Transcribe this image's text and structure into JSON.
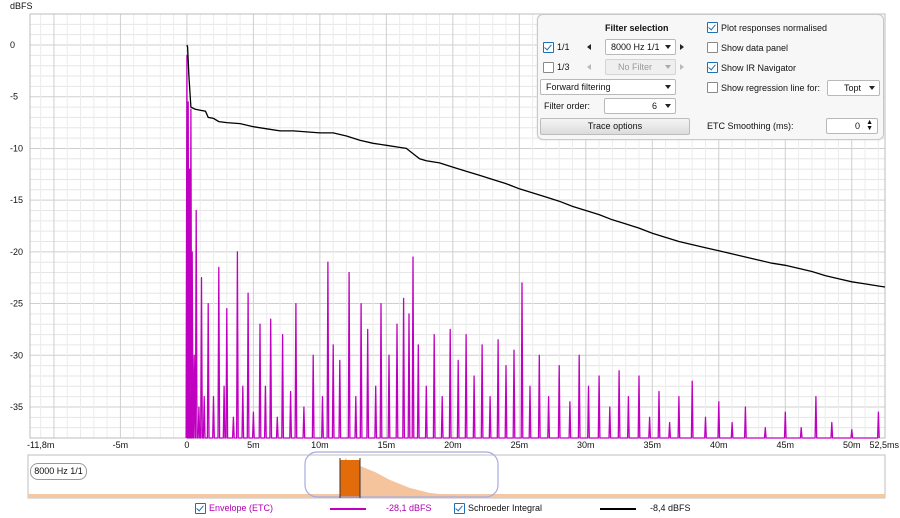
{
  "chart_data": {
    "type": "line",
    "ylabel": "dBFS",
    "xunit": "ms",
    "xlim": [
      -11.8,
      52.5
    ],
    "ylim": [
      -38,
      3
    ],
    "xticks": [
      -11.8,
      -5,
      0,
      5,
      10,
      15,
      20,
      25,
      30,
      35,
      40,
      45,
      50,
      52.5
    ],
    "xtick_labels": [
      "-11,8m",
      "-5m",
      "0",
      "5m",
      "10m",
      "15m",
      "20m",
      "25m",
      "30m",
      "35m",
      "40m",
      "45m",
      "50m",
      "52,5ms"
    ],
    "yticks": [
      0,
      -5,
      -10,
      -15,
      -20,
      -25,
      -30,
      -35
    ],
    "ytick_labels": [
      "0",
      "-5",
      "-10",
      "-15",
      "-20",
      "-25",
      "-30",
      "-35"
    ],
    "grid": true,
    "series": [
      {
        "name": "Envelope (ETC)",
        "color": "#c000c0",
        "style": "spiky",
        "points": [
          [
            0.0,
            -1.0
          ],
          [
            0.1,
            -5.5
          ],
          [
            0.2,
            -12.0
          ],
          [
            0.3,
            -6.2
          ],
          [
            0.4,
            -20.0
          ],
          [
            0.55,
            -30.0
          ],
          [
            0.7,
            -16.0
          ],
          [
            0.9,
            -35.0
          ],
          [
            1.1,
            -22.5
          ],
          [
            1.3,
            -34.0
          ],
          [
            1.6,
            -25.0
          ],
          [
            2.0,
            -34.0
          ],
          [
            2.4,
            -21.5
          ],
          [
            2.8,
            -33.0
          ],
          [
            3.0,
            -25.5
          ],
          [
            3.5,
            -36.0
          ],
          [
            3.8,
            -20.0
          ],
          [
            4.2,
            -33.0
          ],
          [
            4.6,
            -24.0
          ],
          [
            5.0,
            -35.5
          ],
          [
            5.5,
            -27.0
          ],
          [
            5.9,
            -33.0
          ],
          [
            6.3,
            -26.5
          ],
          [
            6.8,
            -36.0
          ],
          [
            7.2,
            -28.0
          ],
          [
            7.8,
            -33.5
          ],
          [
            8.2,
            -25.0
          ],
          [
            8.8,
            -35.0
          ],
          [
            9.5,
            -30.0
          ],
          [
            10.2,
            -34.0
          ],
          [
            10.6,
            -21.0
          ],
          [
            11.0,
            -29.0
          ],
          [
            11.5,
            -30.5
          ],
          [
            12.2,
            -22.0
          ],
          [
            12.7,
            -34.0
          ],
          [
            13.1,
            -25.0
          ],
          [
            13.6,
            -27.5
          ],
          [
            14.2,
            -33.0
          ],
          [
            14.6,
            -25.0
          ],
          [
            15.2,
            -30.0
          ],
          [
            15.8,
            -27.0
          ],
          [
            16.3,
            -24.5
          ],
          [
            16.7,
            -26.0
          ],
          [
            17.0,
            -20.5
          ],
          [
            17.4,
            -29.0
          ],
          [
            18.0,
            -33.0
          ],
          [
            18.6,
            -28.0
          ],
          [
            19.2,
            -34.0
          ],
          [
            19.8,
            -27.5
          ],
          [
            20.4,
            -30.5
          ],
          [
            21.0,
            -28.0
          ],
          [
            21.6,
            -32.0
          ],
          [
            22.2,
            -29.0
          ],
          [
            22.8,
            -34.0
          ],
          [
            23.4,
            -28.5
          ],
          [
            24.0,
            -31.0
          ],
          [
            24.6,
            -29.5
          ],
          [
            25.2,
            -23.0
          ],
          [
            25.8,
            -33.0
          ],
          [
            26.5,
            -30.0
          ],
          [
            27.2,
            -34.0
          ],
          [
            28.0,
            -31.0
          ],
          [
            28.8,
            -34.5
          ],
          [
            29.5,
            -30.0
          ],
          [
            30.2,
            -33.0
          ],
          [
            31.0,
            -32.0
          ],
          [
            31.8,
            -35.0
          ],
          [
            32.5,
            -31.5
          ],
          [
            33.2,
            -34.0
          ],
          [
            34.0,
            -32.0
          ],
          [
            34.8,
            -36.0
          ],
          [
            35.5,
            -33.5
          ],
          [
            36.3,
            -36.5
          ],
          [
            37.0,
            -34.0
          ],
          [
            38.0,
            -32.5
          ],
          [
            39.0,
            -36.0
          ],
          [
            40.0,
            -34.5
          ],
          [
            41.0,
            -36.5
          ],
          [
            42.0,
            -35.0
          ],
          [
            43.5,
            -37.0
          ],
          [
            45.0,
            -35.5
          ],
          [
            46.2,
            -37.0
          ],
          [
            47.3,
            -34.0
          ],
          [
            48.5,
            -36.5
          ],
          [
            50.0,
            -37.2
          ],
          [
            52.0,
            -35.5
          ]
        ]
      },
      {
        "name": "Schroeder Integral",
        "color": "#000000",
        "style": "line",
        "points": [
          [
            0.0,
            0.0
          ],
          [
            0.05,
            -0.2
          ],
          [
            0.15,
            -3.0
          ],
          [
            0.3,
            -6.0
          ],
          [
            0.6,
            -6.2
          ],
          [
            1.0,
            -6.3
          ],
          [
            1.4,
            -6.4
          ],
          [
            1.6,
            -7.0
          ],
          [
            2.0,
            -7.1
          ],
          [
            2.4,
            -7.4
          ],
          [
            3.0,
            -7.5
          ],
          [
            4.0,
            -7.6
          ],
          [
            5.0,
            -7.9
          ],
          [
            6.0,
            -8.1
          ],
          [
            7.0,
            -8.3
          ],
          [
            8.0,
            -8.3
          ],
          [
            9.0,
            -8.4
          ],
          [
            10.0,
            -8.5
          ],
          [
            11.0,
            -8.5
          ],
          [
            12.0,
            -8.8
          ],
          [
            13.0,
            -9.2
          ],
          [
            14.0,
            -9.5
          ],
          [
            15.0,
            -9.7
          ],
          [
            16.0,
            -9.9
          ],
          [
            16.5,
            -10.0
          ],
          [
            17.0,
            -10.5
          ],
          [
            17.5,
            -11.0
          ],
          [
            18.0,
            -11.2
          ],
          [
            19.0,
            -11.4
          ],
          [
            20.0,
            -11.8
          ],
          [
            21.0,
            -12.2
          ],
          [
            22.0,
            -12.6
          ],
          [
            23.0,
            -13.0
          ],
          [
            24.0,
            -13.4
          ],
          [
            25.0,
            -13.9
          ],
          [
            26.0,
            -14.3
          ],
          [
            27.0,
            -14.7
          ],
          [
            28.0,
            -15.1
          ],
          [
            29.0,
            -15.6
          ],
          [
            30.0,
            -16.0
          ],
          [
            31.0,
            -16.4
          ],
          [
            32.0,
            -16.9
          ],
          [
            33.0,
            -17.3
          ],
          [
            34.0,
            -17.7
          ],
          [
            35.0,
            -18.2
          ],
          [
            36.0,
            -18.6
          ],
          [
            37.0,
            -19.0
          ],
          [
            38.0,
            -19.3
          ],
          [
            39.0,
            -19.6
          ],
          [
            40.0,
            -19.9
          ],
          [
            41.0,
            -20.2
          ],
          [
            42.0,
            -20.5
          ],
          [
            43.0,
            -20.8
          ],
          [
            44.0,
            -21.1
          ],
          [
            45.0,
            -21.3
          ],
          [
            46.0,
            -21.6
          ],
          [
            47.0,
            -21.9
          ],
          [
            48.0,
            -22.3
          ],
          [
            49.0,
            -22.6
          ],
          [
            50.0,
            -22.9
          ],
          [
            51.0,
            -23.1
          ],
          [
            52.0,
            -23.3
          ],
          [
            52.5,
            -23.4
          ]
        ]
      }
    ]
  },
  "panel": {
    "filter_selection_title": "Filter selection",
    "band_1_1_label": "1/1",
    "band_1_1_checked": true,
    "band_1_1_value": "8000 Hz 1/1",
    "band_1_3_label": "1/3",
    "band_1_3_checked": false,
    "band_1_3_value": "No Filter",
    "filtering_mode": "Forward filtering",
    "filter_order_label": "Filter order:",
    "filter_order_value": "6",
    "trace_options_label": "Trace options",
    "plot_normalised_label": "Plot responses normalised",
    "plot_normalised_checked": true,
    "show_data_panel_label": "Show data panel",
    "show_data_panel_checked": false,
    "show_ir_navigator_label": "Show IR Navigator",
    "show_ir_navigator_checked": true,
    "show_regression_label": "Show regression line for:",
    "show_regression_checked": false,
    "regression_value": "Topt",
    "etc_smoothing_label": "ETC Smoothing (ms):",
    "etc_smoothing_value": "0"
  },
  "overview": {
    "band_label": "8000 Hz 1/1"
  },
  "legend": {
    "envelope_label": "Envelope (ETC)",
    "envelope_value": "-28,1 dBFS",
    "envelope_color": "#c000c0",
    "schroeder_label": "Schroeder Integral",
    "schroeder_value": "-8,4 dBFS",
    "schroeder_color": "#000000"
  }
}
